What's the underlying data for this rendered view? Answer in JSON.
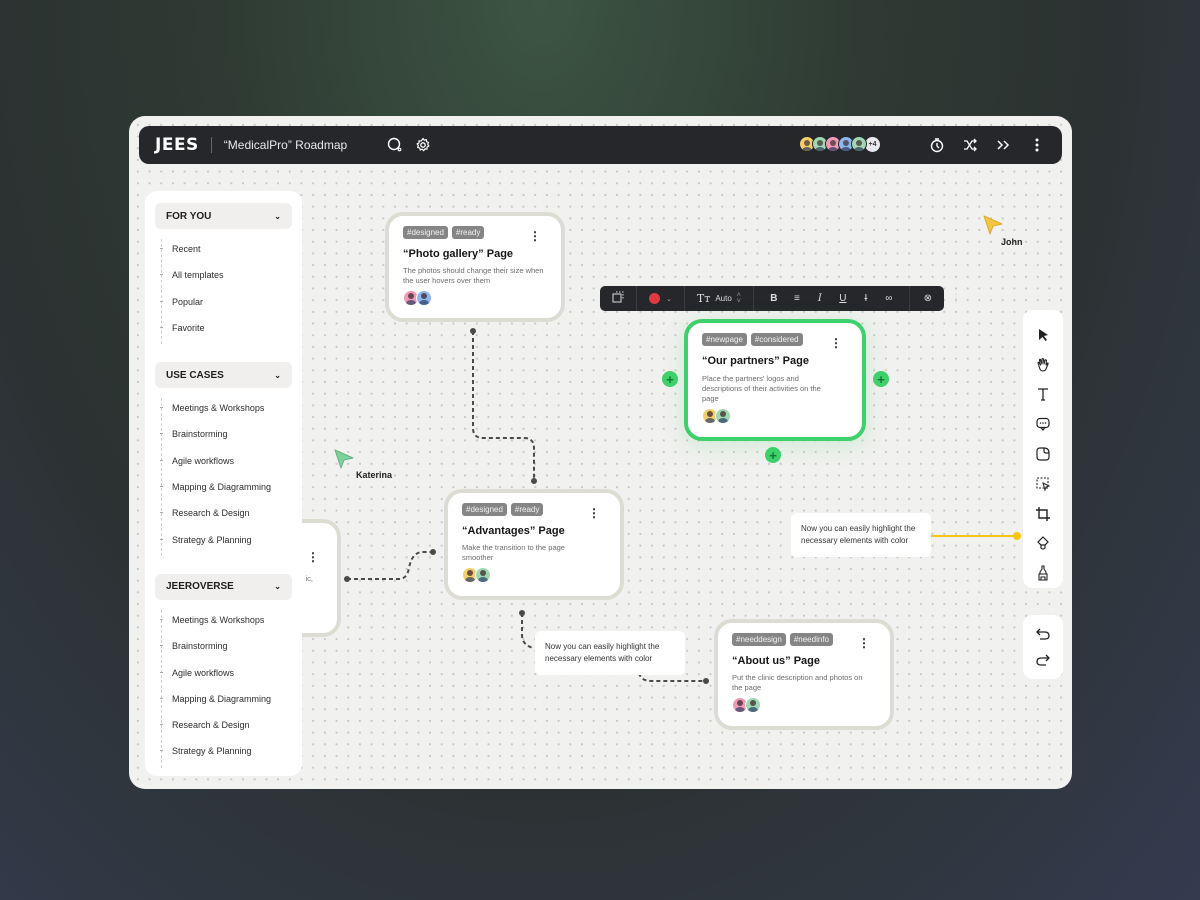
{
  "header": {
    "logo": "JEES",
    "board_title": "“MedicalPro” Roadmap",
    "icons": [
      "search-icon",
      "settings-icon"
    ],
    "collaborators": {
      "avatar_colors": [
        "#f2cf6e",
        "#9fd7b3",
        "#f09ab8",
        "#8bb6ee",
        "#9fd7b3"
      ],
      "more_count": "+4"
    },
    "right_icons": [
      "timer-icon",
      "shuffle-icon",
      "double-chevron-right-icon",
      "more-vertical-icon"
    ]
  },
  "sidebar": {
    "sections": [
      {
        "title": "FOR YOU",
        "items": [
          "Recent",
          "All templates",
          "Popular",
          "Favorite"
        ]
      },
      {
        "title": "USE CASES",
        "items": [
          "Meetings & Workshops",
          "Brainstorming",
          "Agile workflows",
          "Mapping & Diagramming",
          "Research & Design",
          "Strategy & Planning"
        ]
      },
      {
        "title": "JEEROVERSE",
        "items": [
          "Meetings & Workshops",
          "Brainstorming",
          "Agile workflows",
          "Mapping & Diagramming",
          "Research & Design",
          "Strategy & Planning"
        ]
      }
    ]
  },
  "cards": [
    {
      "tags": [
        "#designed",
        "#ready"
      ],
      "title": "“Photo gallery” Page",
      "description": "The photos should change their size when the user hovers over them",
      "avatar_colors": [
        "#f09ab8",
        "#8bb6ee"
      ]
    },
    {
      "tags": [
        "#newpage",
        "#considered"
      ],
      "title": "“Our partners” Page",
      "description": "Place the partners’ logos and descriptions of their activities on the page",
      "avatar_colors": [
        "#f2cf6e",
        "#9fd7b3"
      ],
      "selected": true
    },
    {
      "tags": [
        "#designed",
        "#ready"
      ],
      "title": "“Advantages” Page",
      "description": "Make the transition to the page smoother",
      "avatar_colors": [
        "#f2cf6e",
        "#9fd7b3"
      ]
    },
    {
      "tags": [
        "#needdesign",
        "#needinfo"
      ],
      "title": "“About us” Page",
      "description": "Put the clinic description and photos on the page",
      "avatar_colors": [
        "#f09ab8",
        "#9fd7b3"
      ]
    },
    {
      "partial_text": "ic,"
    }
  ],
  "format_toolbar": {
    "color": "#e0393f",
    "font_size": "Auto",
    "buttons": [
      "frame-icon",
      "color-picker",
      "text-size-icon",
      "bold-icon",
      "align-center-icon",
      "italic-icon",
      "underline-icon",
      "strikethrough-icon",
      "link-icon",
      "style-icon",
      "more-vertical-icon"
    ]
  },
  "notes": [
    "Now you can easily highlight the necessary elements with color",
    "Now you can easily highlight the necessary elements with color"
  ],
  "cursors": [
    {
      "name": "Katerina",
      "color": "#7ed19c"
    },
    {
      "name": "John",
      "color": "#f5c542"
    }
  ],
  "tools": [
    "pointer-icon",
    "hand-icon",
    "text-icon",
    "comment-icon",
    "sticky-note-icon",
    "select-area-icon",
    "crop-icon",
    "shape-icon",
    "pen-icon"
  ],
  "history": [
    "undo-icon",
    "redo-icon"
  ],
  "colors": {
    "accent_green": "#3ed06a",
    "connector_yellow": "#f5c518",
    "dark": "#25272a"
  }
}
